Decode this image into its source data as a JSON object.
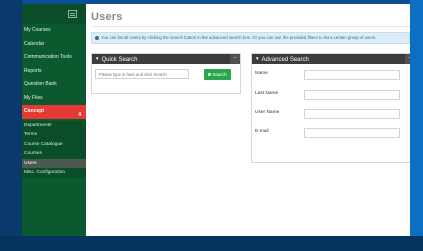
{
  "sidebar": {
    "items": [
      {
        "label": "My Courses"
      },
      {
        "label": "Calendar"
      },
      {
        "label": "Communication Tools"
      },
      {
        "label": "Reports"
      },
      {
        "label": "Question Bank"
      },
      {
        "label": "My Files"
      },
      {
        "label": "Concept",
        "active": true,
        "badge": "4"
      }
    ],
    "subitems": [
      {
        "label": "Departments"
      },
      {
        "label": "Terms"
      },
      {
        "label": "Course Catalogue"
      },
      {
        "label": "Courses"
      },
      {
        "label": "Users",
        "selected": true
      },
      {
        "label": "Misc. Configuration"
      }
    ]
  },
  "page": {
    "title": "Users",
    "info": "You can list all Users by clicking the search button in the advanced search box. Or you can use the provided filters to list a certain group of users."
  },
  "quick_search": {
    "title": "Quick Search",
    "min": "–",
    "placeholder": "Please type in here and click Search",
    "button": "Search"
  },
  "advanced_search": {
    "title": "Advanced Search",
    "min": "–",
    "fields": [
      {
        "label": "Name"
      },
      {
        "label": "Last Name"
      },
      {
        "label": "User Name"
      },
      {
        "label": "E-mail"
      }
    ]
  },
  "colors": {
    "sidebar": "#0b5a2f",
    "active": "#e53935",
    "search_button": "#28a84a",
    "panel_header": "#3c3c3c",
    "info_bg": "#dcedf7"
  }
}
